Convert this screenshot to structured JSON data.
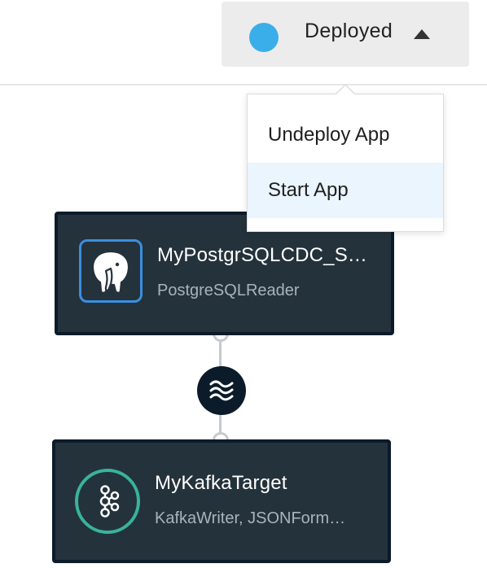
{
  "status": {
    "label": "Deployed",
    "dot_color": "#3aaee9",
    "caret_icon": "caret-up-icon"
  },
  "menu": {
    "items": [
      {
        "label": "Undeploy App"
      },
      {
        "label": "Start App",
        "highlighted": true
      }
    ]
  },
  "flow": {
    "source": {
      "title": "MyPostgrSQLCDC_S…",
      "subtitle": "PostgreSQLReader",
      "icon": "postgresql-elephant-icon",
      "accent": "#3b8ee0"
    },
    "stream": {
      "icon": "stream-waves-icon"
    },
    "target": {
      "title": "MyKafkaTarget",
      "subtitle": "KafkaWriter, JSONForm…",
      "icon": "kafka-icon",
      "accent": "#39b39b"
    }
  },
  "colors": {
    "node_bg": "#24323b",
    "node_border": "#0c1b29",
    "menu_highlight": "#eaf5fd"
  }
}
